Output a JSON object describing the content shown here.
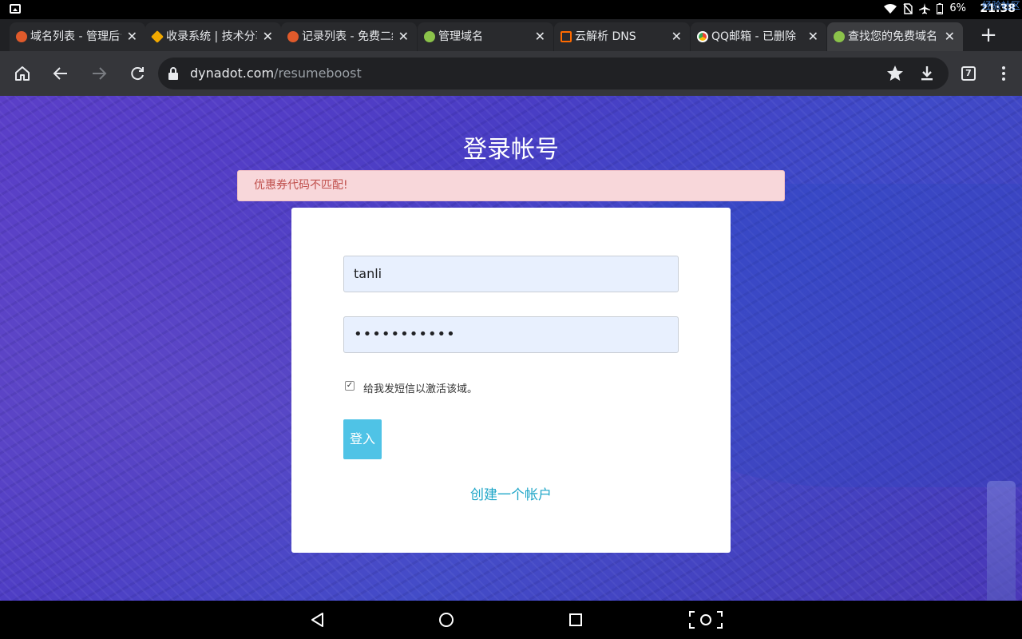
{
  "status_bar": {
    "battery": "6%",
    "time": "21:38",
    "watermark": "经验社区"
  },
  "tabs": [
    {
      "title": "域名列表 - 管理后台",
      "favicon_color": "#e05a2b"
    },
    {
      "title": "收录系统 | 技术分享",
      "favicon_color": "#f2a900"
    },
    {
      "title": "记录列表 - 免费二级",
      "favicon_color": "#e05a2b"
    },
    {
      "title": "管理域名",
      "favicon_color": "#8bc34a"
    },
    {
      "title": "云解析 DNS",
      "favicon_color": "#ff6a00"
    },
    {
      "title": "QQ邮箱 - 已删除",
      "favicon_color": "#1aa1e8"
    },
    {
      "title": "查找您的免费域名",
      "favicon_color": "#8bc34a"
    }
  ],
  "toolbar": {
    "url_domain": "dynadot.com",
    "url_path": "/resumeboost",
    "tab_count": "7"
  },
  "page": {
    "title": "登录帐号",
    "alert": "优惠券代码不匹配!",
    "username_value": "tanli",
    "password_value": "•••••••••••",
    "sms_checkbox_label": "给我发短信以激活该域。",
    "sms_checked": true,
    "login_button": "登入",
    "create_account_link": "创建一个帐户"
  },
  "colors": {
    "alert_bg": "#f8d7da",
    "alert_text": "#c0504d",
    "button": "#4fc3e6",
    "link": "#1fa6c8",
    "field_bg": "#e8f0fe"
  }
}
